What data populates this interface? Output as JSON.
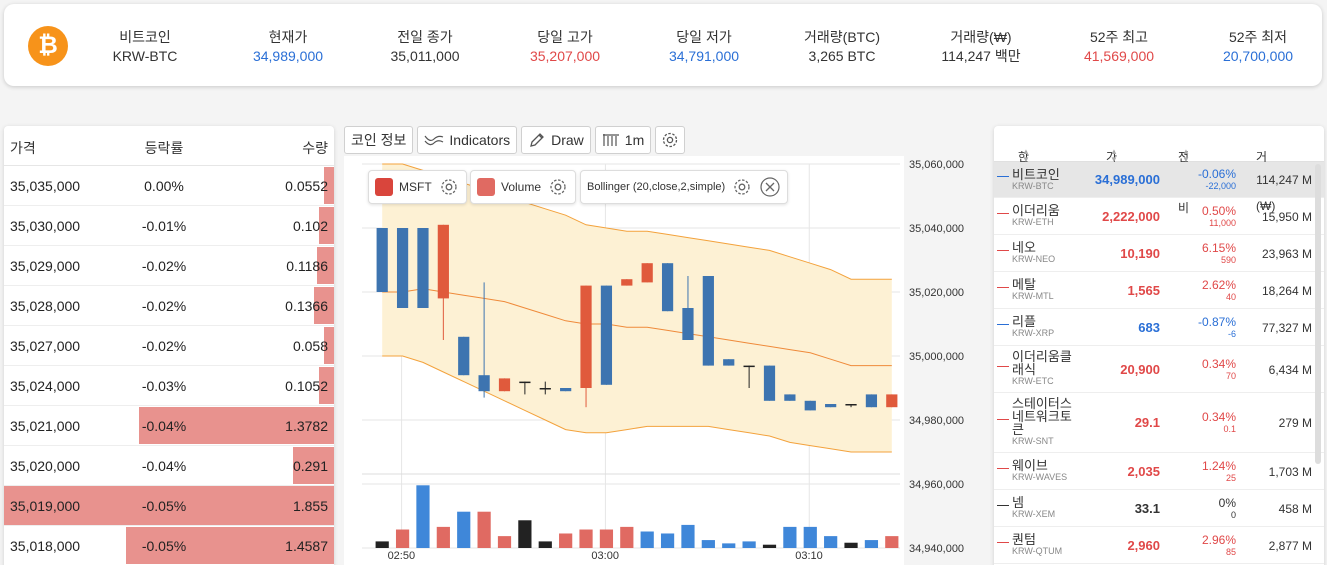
{
  "ticker": {
    "coin_name": "비트코인",
    "coin_code": "KRW-BTC",
    "coin_symbol": "₿",
    "cells": [
      {
        "label": "현재가",
        "value": "34,989,000",
        "color": "blue"
      },
      {
        "label": "전일 종가",
        "value": "35,011,000",
        "color": "normal"
      },
      {
        "label": "당일 고가",
        "value": "35,207,000",
        "color": "red"
      },
      {
        "label": "당일 저가",
        "value": "34,791,000",
        "color": "blue"
      },
      {
        "label": "거래량(BTC)",
        "value": "3,265 BTC",
        "color": "normal"
      },
      {
        "label": "거래량(₩)",
        "value": "114,247 백만",
        "color": "normal"
      },
      {
        "label": "52주 최고",
        "value": "41,569,000",
        "color": "red"
      },
      {
        "label": "52주 최저",
        "value": "20,700,000",
        "color": "blue"
      }
    ]
  },
  "orderbook": {
    "headers": {
      "price": "가격",
      "rate": "등락률",
      "qty": "수량"
    },
    "rows": [
      {
        "price": "35,035,000",
        "rate": "0.00%",
        "qty": "0.0552",
        "bar": 0.03
      },
      {
        "price": "35,030,000",
        "rate": "-0.01%",
        "qty": "0.102",
        "bar": 0.055
      },
      {
        "price": "35,029,000",
        "rate": "-0.02%",
        "qty": "0.1186",
        "bar": 0.064
      },
      {
        "price": "35,028,000",
        "rate": "-0.02%",
        "qty": "0.1366",
        "bar": 0.074
      },
      {
        "price": "35,027,000",
        "rate": "-0.02%",
        "qty": "0.058",
        "bar": 0.031
      },
      {
        "price": "35,024,000",
        "rate": "-0.03%",
        "qty": "0.1052",
        "bar": 0.057
      },
      {
        "price": "35,021,000",
        "rate": "-0.04%",
        "qty": "1.3782",
        "bar": 0.74
      },
      {
        "price": "35,020,000",
        "rate": "-0.04%",
        "qty": "0.291",
        "bar": 0.157
      },
      {
        "price": "35,019,000",
        "rate": "-0.05%",
        "qty": "1.855",
        "bar": 1.0
      },
      {
        "price": "35,018,000",
        "rate": "-0.05%",
        "qty": "1.4587",
        "bar": 0.786
      }
    ]
  },
  "toolbar": {
    "info": "코인 정보",
    "indicators": "Indicators",
    "draw": "Draw",
    "interval": "1m"
  },
  "legend": {
    "msft": "MSFT",
    "volume": "Volume",
    "bollinger": "Bollinger (20,close,2,simple)"
  },
  "chart_data": {
    "type": "candlestick",
    "y_ticks": [
      "35,060,000",
      "35,040,000",
      "35,020,000",
      "35,000,000",
      "34,980,000",
      "34,960,000",
      "34,940,000"
    ],
    "x_ticks": [
      "02:50",
      "03:00",
      "03:10"
    ],
    "ylim": [
      34940000,
      35060000
    ],
    "candles": [
      {
        "o": 35040000,
        "c": 35020000,
        "h": 35040000,
        "l": 35020000
      },
      {
        "o": 35040000,
        "c": 35015000,
        "h": 35040000,
        "l": 35015000
      },
      {
        "o": 35040000,
        "c": 35015000,
        "h": 35040000,
        "l": 35015000
      },
      {
        "o": 35018000,
        "c": 35041000,
        "h": 35041000,
        "l": 35005000
      },
      {
        "o": 35006000,
        "c": 34994000,
        "h": 35006000,
        "l": 34994000
      },
      {
        "o": 34994000,
        "c": 34989000,
        "h": 35023000,
        "l": 34987000
      },
      {
        "o": 34989000,
        "c": 34993000,
        "h": 34993000,
        "l": 34989000
      },
      {
        "o": 34992000,
        "c": 34992000,
        "h": 34992000,
        "l": 34988000
      },
      {
        "o": 34990000,
        "c": 34990000,
        "h": 34992000,
        "l": 34988000
      },
      {
        "o": 34990000,
        "c": 34989000,
        "h": 34990000,
        "l": 34989000
      },
      {
        "o": 34990000,
        "c": 35022000,
        "h": 35022000,
        "l": 34984000
      },
      {
        "o": 35022000,
        "c": 34991000,
        "h": 35022000,
        "l": 34991000
      },
      {
        "o": 35022000,
        "c": 35024000,
        "h": 35024000,
        "l": 35022000
      },
      {
        "o": 35023000,
        "c": 35029000,
        "h": 35029000,
        "l": 35023000
      },
      {
        "o": 35029000,
        "c": 35014000,
        "h": 35029000,
        "l": 35014000
      },
      {
        "o": 35015000,
        "c": 35005000,
        "h": 35025000,
        "l": 35005000
      },
      {
        "o": 35025000,
        "c": 34997000,
        "h": 35025000,
        "l": 34997000
      },
      {
        "o": 34999000,
        "c": 34997000,
        "h": 34999000,
        "l": 34997000
      },
      {
        "o": 34997000,
        "c": 34997000,
        "h": 34997000,
        "l": 34990000
      },
      {
        "o": 34997000,
        "c": 34986000,
        "h": 34997000,
        "l": 34986000
      },
      {
        "o": 34988000,
        "c": 34986000,
        "h": 34988000,
        "l": 34986000
      },
      {
        "o": 34986000,
        "c": 34983000,
        "h": 34986000,
        "l": 34983000
      },
      {
        "o": 34985000,
        "c": 34984000,
        "h": 34985000,
        "l": 34984000
      },
      {
        "o": 34985000,
        "c": 34985000,
        "h": 34985000,
        "l": 34984000
      },
      {
        "o": 34988000,
        "c": 34984000,
        "h": 34988000,
        "l": 34984000
      },
      {
        "o": 34984000,
        "c": 34988000,
        "h": 34988000,
        "l": 34984000
      }
    ],
    "volumes": [
      0.1,
      0.28,
      0.95,
      0.32,
      0.55,
      0.55,
      0.18,
      0.42,
      0.1,
      0.22,
      0.28,
      0.28,
      0.32,
      0.25,
      0.22,
      0.35,
      0.12,
      0.07,
      0.1,
      0.05,
      0.32,
      0.32,
      0.18,
      0.08,
      0.12,
      0.18
    ],
    "volume_colors": [
      "dark",
      "red",
      "blue",
      "red",
      "blue",
      "red",
      "red",
      "dark",
      "dark",
      "red",
      "red",
      "red",
      "red",
      "blue",
      "blue",
      "blue",
      "blue",
      "blue",
      "blue",
      "dark",
      "blue",
      "blue",
      "blue",
      "dark",
      "blue",
      "red"
    ],
    "band_upper": [
      35060000,
      35060000,
      35058000,
      35056000,
      35054000,
      35052000,
      35050000,
      35048000,
      35046000,
      35044000,
      35041000,
      35040000,
      35039000,
      35039000,
      35038000,
      35037000,
      35036000,
      35035000,
      35034000,
      35033000,
      35031000,
      35029000,
      35027000,
      35024000,
      35024000,
      35024000
    ],
    "band_lower": [
      35000000,
      35000000,
      34998000,
      34995000,
      34992000,
      34989000,
      34986000,
      34983000,
      34980000,
      34977000,
      34976000,
      34976000,
      34977000,
      34978000,
      34978000,
      34978000,
      34978000,
      34977000,
      34976000,
      34975000,
      34973000,
      34972000,
      34971000,
      34970000,
      34970000,
      34970000
    ],
    "band_mid": [
      35020000,
      35020000,
      35021000,
      35020000,
      35019000,
      35018000,
      35017000,
      35015000,
      35013000,
      35011000,
      35010000,
      35010000,
      35009000,
      35009000,
      35008000,
      35007000,
      35006000,
      35005000,
      35004000,
      35003000,
      35002000,
      35001000,
      34999000,
      34997000,
      34997000,
      34997000
    ]
  },
  "coinlist": {
    "headers": {
      "name": "한글명",
      "price": "가격",
      "change": "전일 대비",
      "volume": "거래량(₩)"
    },
    "rows": [
      {
        "name": "비트코인",
        "code": "KRW-BTC",
        "price": "34,989,000",
        "rate": "-0.06%",
        "diff": "-22,000",
        "vol": "114,247 M",
        "dir": "down",
        "h": 36,
        "sel": true
      },
      {
        "name": "이더리움",
        "code": "KRW-ETH",
        "price": "2,222,000",
        "rate": "0.50%",
        "diff": "11,000",
        "vol": "15,950 M",
        "dir": "up",
        "h": 37
      },
      {
        "name": "네오",
        "code": "KRW-NEO",
        "price": "10,190",
        "rate": "6.15%",
        "diff": "590",
        "vol": "23,963 M",
        "dir": "up",
        "h": 37
      },
      {
        "name": "메탈",
        "code": "KRW-MTL",
        "price": "1,565",
        "rate": "2.62%",
        "diff": "40",
        "vol": "18,264 M",
        "dir": "up",
        "h": 37
      },
      {
        "name": "리플",
        "code": "KRW-XRP",
        "price": "683",
        "rate": "-0.87%",
        "diff": "-6",
        "vol": "77,327 M",
        "dir": "down",
        "h": 37
      },
      {
        "name": "이더리움클래식",
        "code": "KRW-ETC",
        "price": "20,900",
        "rate": "0.34%",
        "diff": "70",
        "vol": "6,434 M",
        "dir": "up",
        "h": 47
      },
      {
        "name": "스테이터스네트워크토큰",
        "code": "KRW-SNT",
        "price": "29.1",
        "rate": "0.34%",
        "diff": "0.1",
        "vol": "279 M",
        "dir": "up",
        "h": 60
      },
      {
        "name": "웨이브",
        "code": "KRW-WAVES",
        "price": "2,035",
        "rate": "1.24%",
        "diff": "25",
        "vol": "1,703 M",
        "dir": "up",
        "h": 37
      },
      {
        "name": "넴",
        "code": "KRW-XEM",
        "price": "33.1",
        "rate": "0%",
        "diff": "0",
        "vol": "458 M",
        "dir": "flat",
        "h": 37
      },
      {
        "name": "퀀텀",
        "code": "KRW-QTUM",
        "price": "2,960",
        "rate": "2.96%",
        "diff": "85",
        "vol": "2,877 M",
        "dir": "up",
        "h": 37
      }
    ]
  },
  "colors": {
    "up": "#e04848",
    "down": "#2a6fd6",
    "candle_up": "#e05a3c",
    "candle_down": "#3d74b0",
    "band_fill": "#fdf1d4",
    "band_line": "#f3a23c",
    "orderbook_bar": "#e8928e"
  }
}
